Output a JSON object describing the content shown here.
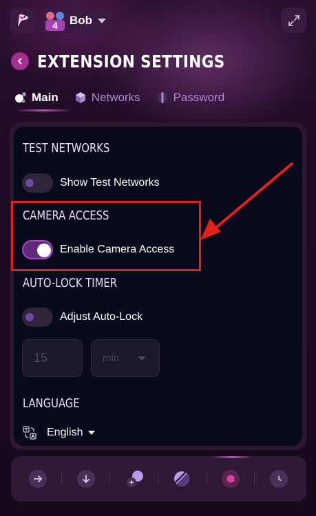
{
  "account": {
    "name": "Bob",
    "badge": "4"
  },
  "page": {
    "title": "EXTENSION SETTINGS"
  },
  "tabs": [
    {
      "label": "Main",
      "active": true,
      "icon": "main-icon"
    },
    {
      "label": "Networks",
      "active": false,
      "icon": "cube-icon"
    },
    {
      "label": "Password",
      "active": false,
      "icon": "password-icon"
    }
  ],
  "sections": {
    "test_networks": {
      "title": "TEST NETWORKS",
      "toggle_label": "Show Test Networks",
      "enabled": false
    },
    "camera_access": {
      "title": "CAMERA ACCESS",
      "toggle_label": "Enable Camera Access",
      "enabled": true
    },
    "auto_lock": {
      "title": "AUTO-LOCK TIMER",
      "toggle_label": "Adjust Auto-Lock",
      "enabled": false,
      "value": "15",
      "unit": "min"
    },
    "language": {
      "title": "LANGUAGE",
      "value": "English"
    }
  },
  "bottom_nav": [
    {
      "icon": "send-icon"
    },
    {
      "icon": "receive-icon"
    },
    {
      "icon": "swap-icon"
    },
    {
      "icon": "stake-icon"
    },
    {
      "icon": "hexagon-icon",
      "active": true
    },
    {
      "icon": "history-icon"
    }
  ],
  "colors": {
    "accent": "#d24ab5",
    "background": "#1a0a1e",
    "panel": "#0a0a1d",
    "annotation": "#e3201b"
  }
}
